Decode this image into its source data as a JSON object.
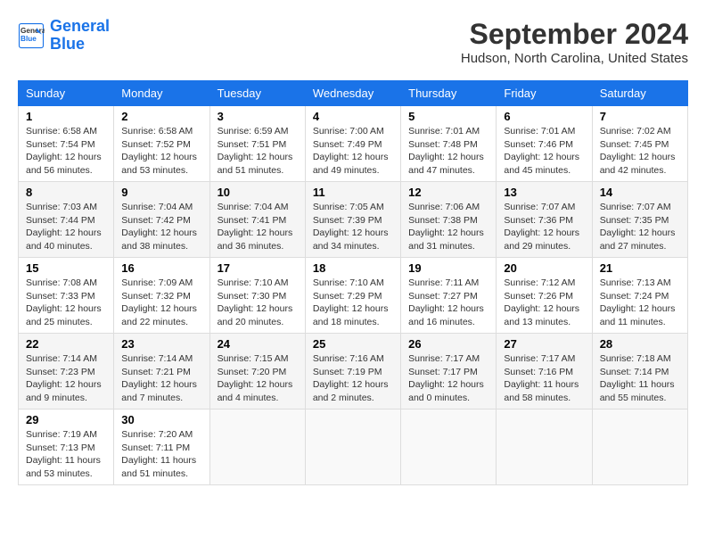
{
  "header": {
    "logo_line1": "General",
    "logo_line2": "Blue",
    "month": "September 2024",
    "location": "Hudson, North Carolina, United States"
  },
  "weekdays": [
    "Sunday",
    "Monday",
    "Tuesday",
    "Wednesday",
    "Thursday",
    "Friday",
    "Saturday"
  ],
  "weeks": [
    [
      {
        "day": "1",
        "lines": [
          "Sunrise: 6:58 AM",
          "Sunset: 7:54 PM",
          "Daylight: 12 hours",
          "and 56 minutes."
        ]
      },
      {
        "day": "2",
        "lines": [
          "Sunrise: 6:58 AM",
          "Sunset: 7:52 PM",
          "Daylight: 12 hours",
          "and 53 minutes."
        ]
      },
      {
        "day": "3",
        "lines": [
          "Sunrise: 6:59 AM",
          "Sunset: 7:51 PM",
          "Daylight: 12 hours",
          "and 51 minutes."
        ]
      },
      {
        "day": "4",
        "lines": [
          "Sunrise: 7:00 AM",
          "Sunset: 7:49 PM",
          "Daylight: 12 hours",
          "and 49 minutes."
        ]
      },
      {
        "day": "5",
        "lines": [
          "Sunrise: 7:01 AM",
          "Sunset: 7:48 PM",
          "Daylight: 12 hours",
          "and 47 minutes."
        ]
      },
      {
        "day": "6",
        "lines": [
          "Sunrise: 7:01 AM",
          "Sunset: 7:46 PM",
          "Daylight: 12 hours",
          "and 45 minutes."
        ]
      },
      {
        "day": "7",
        "lines": [
          "Sunrise: 7:02 AM",
          "Sunset: 7:45 PM",
          "Daylight: 12 hours",
          "and 42 minutes."
        ]
      }
    ],
    [
      {
        "day": "8",
        "lines": [
          "Sunrise: 7:03 AM",
          "Sunset: 7:44 PM",
          "Daylight: 12 hours",
          "and 40 minutes."
        ]
      },
      {
        "day": "9",
        "lines": [
          "Sunrise: 7:04 AM",
          "Sunset: 7:42 PM",
          "Daylight: 12 hours",
          "and 38 minutes."
        ]
      },
      {
        "day": "10",
        "lines": [
          "Sunrise: 7:04 AM",
          "Sunset: 7:41 PM",
          "Daylight: 12 hours",
          "and 36 minutes."
        ]
      },
      {
        "day": "11",
        "lines": [
          "Sunrise: 7:05 AM",
          "Sunset: 7:39 PM",
          "Daylight: 12 hours",
          "and 34 minutes."
        ]
      },
      {
        "day": "12",
        "lines": [
          "Sunrise: 7:06 AM",
          "Sunset: 7:38 PM",
          "Daylight: 12 hours",
          "and 31 minutes."
        ]
      },
      {
        "day": "13",
        "lines": [
          "Sunrise: 7:07 AM",
          "Sunset: 7:36 PM",
          "Daylight: 12 hours",
          "and 29 minutes."
        ]
      },
      {
        "day": "14",
        "lines": [
          "Sunrise: 7:07 AM",
          "Sunset: 7:35 PM",
          "Daylight: 12 hours",
          "and 27 minutes."
        ]
      }
    ],
    [
      {
        "day": "15",
        "lines": [
          "Sunrise: 7:08 AM",
          "Sunset: 7:33 PM",
          "Daylight: 12 hours",
          "and 25 minutes."
        ]
      },
      {
        "day": "16",
        "lines": [
          "Sunrise: 7:09 AM",
          "Sunset: 7:32 PM",
          "Daylight: 12 hours",
          "and 22 minutes."
        ]
      },
      {
        "day": "17",
        "lines": [
          "Sunrise: 7:10 AM",
          "Sunset: 7:30 PM",
          "Daylight: 12 hours",
          "and 20 minutes."
        ]
      },
      {
        "day": "18",
        "lines": [
          "Sunrise: 7:10 AM",
          "Sunset: 7:29 PM",
          "Daylight: 12 hours",
          "and 18 minutes."
        ]
      },
      {
        "day": "19",
        "lines": [
          "Sunrise: 7:11 AM",
          "Sunset: 7:27 PM",
          "Daylight: 12 hours",
          "and 16 minutes."
        ]
      },
      {
        "day": "20",
        "lines": [
          "Sunrise: 7:12 AM",
          "Sunset: 7:26 PM",
          "Daylight: 12 hours",
          "and 13 minutes."
        ]
      },
      {
        "day": "21",
        "lines": [
          "Sunrise: 7:13 AM",
          "Sunset: 7:24 PM",
          "Daylight: 12 hours",
          "and 11 minutes."
        ]
      }
    ],
    [
      {
        "day": "22",
        "lines": [
          "Sunrise: 7:14 AM",
          "Sunset: 7:23 PM",
          "Daylight: 12 hours",
          "and 9 minutes."
        ]
      },
      {
        "day": "23",
        "lines": [
          "Sunrise: 7:14 AM",
          "Sunset: 7:21 PM",
          "Daylight: 12 hours",
          "and 7 minutes."
        ]
      },
      {
        "day": "24",
        "lines": [
          "Sunrise: 7:15 AM",
          "Sunset: 7:20 PM",
          "Daylight: 12 hours",
          "and 4 minutes."
        ]
      },
      {
        "day": "25",
        "lines": [
          "Sunrise: 7:16 AM",
          "Sunset: 7:19 PM",
          "Daylight: 12 hours",
          "and 2 minutes."
        ]
      },
      {
        "day": "26",
        "lines": [
          "Sunrise: 7:17 AM",
          "Sunset: 7:17 PM",
          "Daylight: 12 hours",
          "and 0 minutes."
        ]
      },
      {
        "day": "27",
        "lines": [
          "Sunrise: 7:17 AM",
          "Sunset: 7:16 PM",
          "Daylight: 11 hours",
          "and 58 minutes."
        ]
      },
      {
        "day": "28",
        "lines": [
          "Sunrise: 7:18 AM",
          "Sunset: 7:14 PM",
          "Daylight: 11 hours",
          "and 55 minutes."
        ]
      }
    ],
    [
      {
        "day": "29",
        "lines": [
          "Sunrise: 7:19 AM",
          "Sunset: 7:13 PM",
          "Daylight: 11 hours",
          "and 53 minutes."
        ]
      },
      {
        "day": "30",
        "lines": [
          "Sunrise: 7:20 AM",
          "Sunset: 7:11 PM",
          "Daylight: 11 hours",
          "and 51 minutes."
        ]
      },
      null,
      null,
      null,
      null,
      null
    ]
  ]
}
